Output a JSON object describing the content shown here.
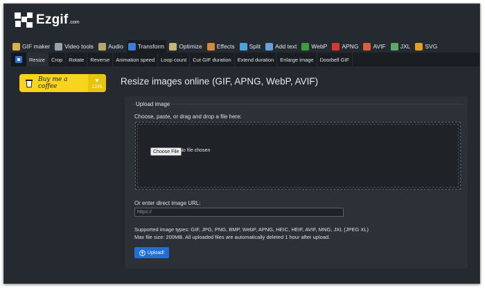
{
  "header": {
    "brand": "Ezgif",
    "tld": ".com"
  },
  "main_nav": [
    {
      "label": "GIF maker",
      "icon": "gif-maker-icon",
      "color": "#d8b04a"
    },
    {
      "label": "Video tools",
      "icon": "film-icon",
      "color": "#9aa3ad"
    },
    {
      "label": "Audio",
      "icon": "audio-icon",
      "color": "#b7a86a"
    },
    {
      "label": "Transform",
      "icon": "transform-icon",
      "color": "#3b7ddd"
    },
    {
      "label": "Optimize",
      "icon": "optimize-icon",
      "color": "#c9b37a"
    },
    {
      "label": "Effects",
      "icon": "effects-icon",
      "color": "#d48a3a"
    },
    {
      "label": "Split",
      "icon": "split-icon",
      "color": "#4aa3df"
    },
    {
      "label": "Add text",
      "icon": "add-text-icon",
      "color": "#6aa0d8"
    },
    {
      "label": "WebP",
      "icon": "webp-icon",
      "color": "#3e9b3e"
    },
    {
      "label": "APNG",
      "icon": "apng-icon",
      "color": "#d83a2a"
    },
    {
      "label": "AVIF",
      "icon": "avif-icon",
      "color": "#d8603a"
    },
    {
      "label": "JXL",
      "icon": "jxl-icon",
      "color": "#5fa86a"
    },
    {
      "label": "SVG",
      "icon": "svg-icon",
      "color": "#e0a020"
    }
  ],
  "sub_nav": [
    "Resize",
    "Crop",
    "Rotate",
    "Reverse",
    "Animation speed",
    "Loop count",
    "Cut GIF duration",
    "Extend duration",
    "Enlarge image",
    "Doorbell GIF"
  ],
  "coffee": {
    "label": "Buy me a coffee",
    "count": "1235",
    "heart": "♥",
    "bg": "#f7d51d"
  },
  "page_title": "Resize images online (GIF, APNG, WebP, AVIF)",
  "upload": {
    "legend": "Upload image",
    "choose_label": "Choose, paste, or drag and drop a file here:",
    "file_button": "Choose File",
    "no_file": "No file chosen",
    "url_label": "Or enter direct image URL:",
    "url_placeholder": "https://",
    "supported_line1": "Supported image types: GIF, JPG, PNG, BMP, WebP, APNG, HEIC, HEIF, AVIF, MNG, JXL (JPEG XL)",
    "supported_line2": "Max file size: 200MB. All uploaded files are automatically deleted 1 hour after upload.",
    "button": "Upload!",
    "accent": "#1f6fd6"
  }
}
